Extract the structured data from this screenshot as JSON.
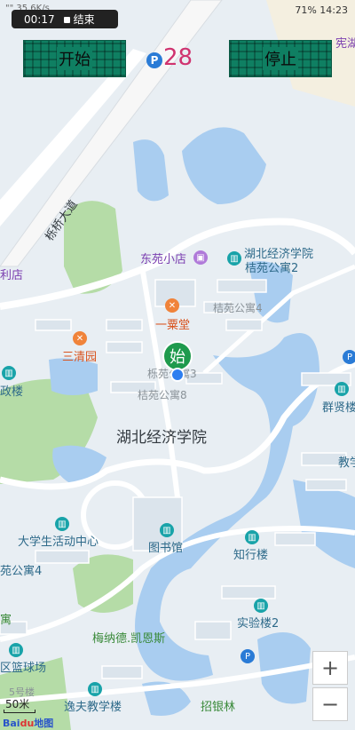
{
  "status_bar": {
    "left_text": "\"\" 35.6K/s",
    "battery": "71%",
    "time": "14:23"
  },
  "recording": {
    "elapsed": "00:17",
    "end_label": "结束"
  },
  "controls": {
    "start_label": "开始",
    "stop_label": "停止",
    "parking_letter": "P",
    "counter": "28"
  },
  "map": {
    "start_marker": "始",
    "labels": {
      "road": "栎桥大道",
      "top_right": "宪湖",
      "shop_left": "利店",
      "dongyuan_store": "东苑小店",
      "school_building": "湖北经济学院",
      "jieyuan2": "桔苑公寓2",
      "jieyuan4": "桔苑公寓4",
      "yisutang": "一粟堂",
      "sanqingyuan": "三清园",
      "zheng_building": "政楼",
      "lianyuan3": "栎苑公寓3",
      "jieyuan8": "桔苑公寓8",
      "qunxian": "群贤楼",
      "campus": "湖北经济学院",
      "teach_right": "教学",
      "activity_center": "大学生活动中心",
      "library": "图书馆",
      "zhixing": "知行楼",
      "apartment4": "苑公寓4",
      "lab2": "实验楼2",
      "mennad": "梅纳德.凯恩斯",
      "yu": "寓",
      "court": "区篮球场",
      "building5": "5号楼",
      "yifu": "逸夫教学楼",
      "zhaoyin": "招银林"
    }
  },
  "zoom": {
    "in": "+",
    "out": "−"
  },
  "scale": {
    "text": "50米"
  },
  "logo": {
    "text": "Bai",
    "accent": "du",
    "suffix": "地图"
  },
  "colors": {
    "water": "#a9cdf0",
    "green": "#b5dca7",
    "road": "#ffffff",
    "building": "#dde6ee",
    "button": "#0f7f62",
    "counter": "#d0336f",
    "start_marker": "#1e9a4d"
  }
}
